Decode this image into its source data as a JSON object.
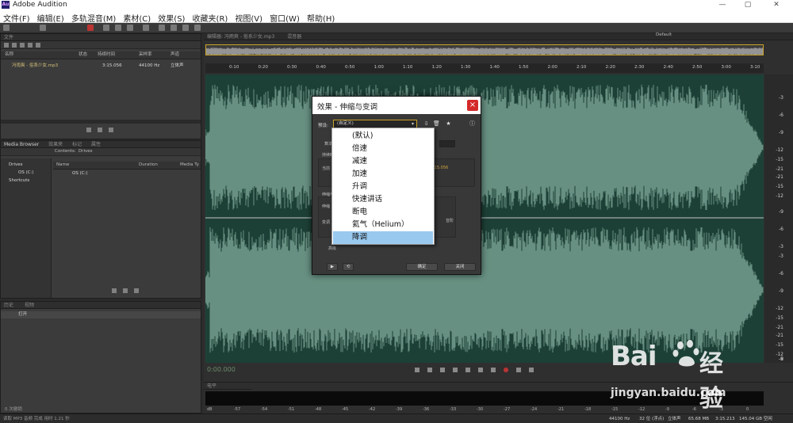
{
  "app": {
    "logo": "Au",
    "title": "Adobe Audition",
    "window_controls": [
      "—",
      "▢",
      "✕"
    ]
  },
  "menu": [
    "文件(F)",
    "编辑(E)",
    "多轨混音(M)",
    "素材(C)",
    "效果(S)",
    "收藏夹(R)",
    "视图(V)",
    "窗口(W)",
    "帮助(H)"
  ],
  "files_panel": {
    "tab": "文件",
    "columns": [
      "名称",
      "状态",
      "持续时间",
      "采样率",
      "声道"
    ],
    "rows": [
      {
        "name": "冯雨爽 - 俗系少女.mp3",
        "duration": "3:15.056",
        "rate": "44100 Hz",
        "channels": "立体声"
      }
    ]
  },
  "media_browser": {
    "tabs": [
      "Media Browser",
      "效果夹",
      "标记",
      "属性"
    ],
    "contents_label": "Contents:",
    "contents_value": "Drives",
    "tree": [
      "Drives",
      "OS (C:)",
      "Shortcuts"
    ],
    "columns": [
      "Name",
      "Duration",
      "Media Ty"
    ],
    "rows": [
      "OS (C:)"
    ]
  },
  "history_panel": {
    "tabs": [
      "历史",
      "视频"
    ],
    "rows": [
      "打开"
    ],
    "footer": "0 次撤销"
  },
  "editor": {
    "tab": "编辑器: 冯雨爽 - 俗系少女.mp3",
    "tab2": "混音器",
    "preset": "Default",
    "timeline": [
      "0:10",
      "0:20",
      "0:30",
      "0:40",
      "0:50",
      "1:00",
      "1:10",
      "1:20",
      "1:30",
      "1:40",
      "1:50",
      "2:00",
      "2:10",
      "2:20",
      "2:30",
      "2:40",
      "2:50",
      "3:00",
      "3:10"
    ],
    "db_labels": [
      "-3",
      "-6",
      "-9",
      "-12",
      "-15",
      "-21",
      "-21",
      "-15",
      "-12",
      "-9",
      "-6",
      "-3",
      "-3",
      "-6",
      "-9",
      "-12",
      "-15",
      "-21",
      "-21",
      "-15",
      "-12",
      "-9",
      "-6",
      "-3"
    ],
    "timecode": "0:00.000"
  },
  "levels": {
    "tab": "电平",
    "labels": [
      "dB",
      "-57",
      "-54",
      "-51",
      "-48",
      "-45",
      "-42",
      "-39",
      "-36",
      "-33",
      "-30",
      "-27",
      "-24",
      "-21",
      "-18",
      "-15",
      "-12",
      "-9",
      "-6",
      "-3",
      "0"
    ]
  },
  "status": {
    "left": "读取 MP3 音频 完成 用时 1.21 秒",
    "rate": "44100 Hz",
    "bits": "32 位 (浮点)",
    "channels": "立体声",
    "size": "65.68 MB",
    "duration": "3:15.213",
    "free": "145.04 GB 空闲"
  },
  "dialog": {
    "title": "效果 - 伸缩与变调",
    "close": "×",
    "preset_label": "预设:",
    "preset_value": "(自定义)",
    "algorithm_label": "算法",
    "stretch_group": "持续时间",
    "current_label": "当前",
    "current_value": ":15.056",
    "pitch_group": "伸缩与变调",
    "pitch_label": "伸缩",
    "shift_label": "变调",
    "semitone_label": "音阶",
    "advanced": "高级",
    "ok": "确定",
    "cancel": "关闭"
  },
  "dropdown": {
    "items": [
      "(默认)",
      "倍速",
      "减速",
      "加速",
      "升调",
      "快速讲话",
      "断电",
      "氦气（Helium）",
      "降调"
    ],
    "selected_index": 8
  },
  "watermark": {
    "brand": "Bai",
    "brand_suffix": "经验",
    "url": "jingyan.baidu.com"
  },
  "colors": {
    "waveform_bg": "#1d4036",
    "waveform": "#a9d6c4",
    "accent": "#c9a227",
    "selected": "#99c9ef",
    "close": "#d42a2a"
  }
}
